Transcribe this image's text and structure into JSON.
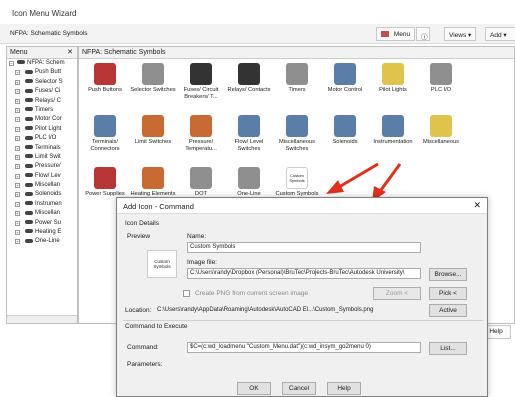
{
  "window": {
    "title": "Icon Menu Wizard"
  },
  "toolbar": {
    "path": "NFPA: Schematic Symbols",
    "menu_label": "Menu",
    "views_label": "Views ▾",
    "add_label": "Add ▾"
  },
  "menu": {
    "header": "Menu",
    "close": "✕",
    "items": [
      "NFPA: Schem",
      "Push Butt",
      "Selector S",
      "Fuses/ Ci",
      "Relays/ C",
      "Timers",
      "Motor Cor",
      "Pilot Light",
      "PLC I/O",
      "Terminals",
      "Limit Swit",
      "Pressure/",
      "Flow/ Lev",
      "Miscellan",
      "Solenoids",
      "Instrumen",
      "Miscellan",
      "Power Su",
      "Heating E",
      "One-Line"
    ]
  },
  "gallery": {
    "header": "NFPA: Schematic Symbols",
    "cells": [
      "Push Buttons",
      "Selector Switches",
      "Fuses/ Circuit Breakers/ T...",
      "Relays/ Contacts",
      "Timers",
      "Motor Control",
      "Pilot Lights",
      "PLC I/O",
      "Terminals/ Connectors",
      "Limit Switches",
      "Pressure/ Temperatu...",
      "Flow/ Level Switches",
      "Miscellaneous Switches",
      "Solenoids",
      "Instrumentation",
      "Miscellaneous",
      "Power Supplies",
      "Heating Elements",
      "DOT",
      "One-Line Components",
      "Custom Symbols"
    ],
    "custom_icon_text": "Custom Symbols"
  },
  "help_label": "Help",
  "dialog": {
    "title": "Add Icon - Command",
    "close": "✕",
    "icon_details": "Icon Details",
    "preview": "Preview",
    "preview_text": "Custom Symbols",
    "name_label": "Name:",
    "name_value": "Custom Symbols",
    "image_label": "Image file:",
    "image_value": "C:\\Users\\randy\\Dropbox (Personal)\\BruTec\\Projects-BruTec\\Autodesk University\\",
    "browse": "Browse...",
    "create_png": "Create PNG from current screen image",
    "zoom": "Zoom <",
    "pick": "Pick <",
    "location_label": "Location:",
    "location_value": "C:\\Users\\randy\\AppData\\Roaming\\Autodesk\\AutoCAD El...\\Custom_Symbols.png",
    "active": "Active",
    "command_section": "Command to Execute",
    "command_label": "Command:",
    "command_value": "$C=(c:wd_loadmenu \"Custom_Menu.dat\")(c:wd_insym_go2menu 0)",
    "list": "List...",
    "parameters_label": "Parameters:",
    "ok": "OK",
    "cancel": "Cancel",
    "help": "Help"
  }
}
